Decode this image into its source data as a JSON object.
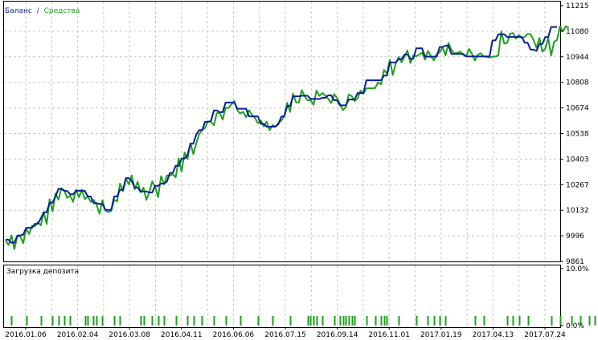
{
  "chart_data": [
    {
      "type": "line",
      "title": "",
      "legend": {
        "placement": "top-left",
        "separator": "/"
      },
      "xlabel": "",
      "ylabel": "",
      "ylim": [
        9861,
        11215
      ],
      "y_ticks": [
        "11215",
        "11080",
        "10944",
        "10808",
        "10674",
        "10538",
        "10403",
        "10267",
        "10132",
        "9996",
        "9861"
      ],
      "x_ticks": [
        "2016.01.06",
        "2016.02.04",
        "2016.03.08",
        "2016.04.11",
        "2016.06.06",
        "2016.07.15",
        "2016.09.14",
        "2016.11.01",
        "2017.01.19",
        "2017.04.13",
        "2017.07.24"
      ],
      "grid": true,
      "series": [
        {
          "name": "Баланс",
          "color": "#0a1f96",
          "values": [
            9976,
            9976,
            9960,
            9960,
            9998,
            9998,
            10003,
            10039,
            10039,
            10039,
            10060,
            10060,
            10089,
            10121,
            10121,
            10172,
            10172,
            10203,
            10245,
            10245,
            10234,
            10234,
            10216,
            10216,
            10235,
            10235,
            10235,
            10235,
            10205,
            10205,
            10169,
            10169,
            10165,
            10165,
            10134,
            10134,
            10134,
            10205,
            10205,
            10240,
            10240,
            10302,
            10302,
            10285,
            10252,
            10252,
            10231,
            10231,
            10231,
            10226,
            10226,
            10261,
            10261,
            10273,
            10273,
            10284,
            10329,
            10329,
            10367,
            10367,
            10405,
            10405,
            10423,
            10484,
            10484,
            10533,
            10556,
            10556,
            10600,
            10600,
            10603,
            10660,
            10660,
            10651,
            10651,
            10702,
            10702,
            10702,
            10702,
            10669,
            10669,
            10669,
            10669,
            10629,
            10629,
            10629,
            10629,
            10589,
            10589,
            10574,
            10574,
            10574,
            10574,
            10588,
            10628,
            10628,
            10683,
            10683,
            10735,
            10735,
            10735,
            10738,
            10738,
            10738,
            10721,
            10721,
            10721,
            10721,
            10727,
            10727,
            10740,
            10740,
            10714,
            10714,
            10687,
            10687,
            10687,
            10718,
            10718,
            10718,
            10752,
            10752,
            10752,
            10820,
            10820,
            10820,
            10820,
            10820,
            10820,
            10845,
            10845,
            10914,
            10914,
            10914,
            10932,
            10932,
            10956,
            10956,
            10933,
            10933,
            10989,
            10989,
            10989,
            10945,
            10945,
            10945,
            10945,
            10945,
            10996,
            10996,
            11003,
            11003,
            10959,
            10959,
            10959,
            10959,
            10959,
            10946,
            10946,
            10946,
            10946,
            10946,
            10946,
            10946,
            10946,
            10946,
            11031,
            11031,
            11063,
            11063,
            11063,
            11049,
            11049,
            11049,
            11049,
            11049,
            11049,
            11018,
            11018,
            10982,
            10982,
            10975,
            11012,
            11012,
            11048,
            11048,
            11102,
            11102,
            11102
          ]
        },
        {
          "name": "Средства",
          "color": "#1ea01e",
          "values": [
            9972,
            9948,
            9998,
            9926,
            9996,
            9994,
            9957,
            10035,
            10006,
            10050,
            10047,
            10069,
            10052,
            10122,
            10059,
            10190,
            10126,
            10221,
            10188,
            10248,
            10237,
            10197,
            10209,
            10177,
            10241,
            10201,
            10240,
            10191,
            10205,
            10176,
            10187,
            10161,
            10113,
            10185,
            10130,
            10122,
            10128,
            10187,
            10179,
            10273,
            10232,
            10299,
            10269,
            10316,
            10242,
            10283,
            10227,
            10251,
            10187,
            10227,
            10285,
            10255,
            10201,
            10312,
            10269,
            10316,
            10315,
            10322,
            10306,
            10407,
            10336,
            10438,
            10402,
            10487,
            10429,
            10486,
            10535,
            10556,
            10568,
            10603,
            10600,
            10582,
            10646,
            10647,
            10612,
            10675,
            10672,
            10693,
            10710,
            10660,
            10644,
            10653,
            10624,
            10661,
            10637,
            10620,
            10593,
            10607,
            10575,
            10601,
            10555,
            10583,
            10574,
            10594,
            10606,
            10630,
            10701,
            10652,
            10750,
            10703,
            10702,
            10768,
            10734,
            10714,
            10714,
            10690,
            10765,
            10737,
            10752,
            10740,
            10721,
            10699,
            10746,
            10726,
            10695,
            10662,
            10678,
            10745,
            10736,
            10710,
            10723,
            10765,
            10750,
            10777,
            10778,
            10777,
            10779,
            10809,
            10798,
            10875,
            10855,
            10928,
            10848,
            10908,
            10943,
            10915,
            10945,
            10978,
            10911,
            10951,
            10947,
            10956,
            10966,
            10929,
            10975,
            10948,
            10925,
            10959,
            10968,
            10994,
            10952,
            11017,
            10981,
            10962,
            10964,
            10972,
            10955,
            10946,
            10986,
            10960,
            10925,
            10955,
            10963,
            10946,
            10944,
            10940,
            10944,
            10946,
            10951,
            11078,
            11014,
            11018,
            11066,
            11070,
            11040,
            11060,
            11043,
            11050,
            11065,
            11063,
            11033,
            10992,
            11044,
            10971,
            10987,
            11044,
            10951,
            11023,
            11033,
            11105,
            11078,
            11105,
            11100
          ]
        }
      ]
    },
    {
      "type": "bar",
      "title": "Загрузка депозита",
      "y_ticks": [
        "10.0%",
        "0.0%"
      ],
      "ylim": [
        0,
        10
      ],
      "x_ticks": [
        "2016.01.06",
        "2016.02.04",
        "2016.03.08",
        "2016.04.11",
        "2016.06.06",
        "2016.07.15",
        "2016.09.14",
        "2016.11.01",
        "2017.01.19",
        "2017.04.13",
        "2017.07.24"
      ],
      "series": [
        {
          "name": "",
          "color": "#1ea01e",
          "index": [
            2,
            7,
            12,
            16,
            18,
            20,
            22,
            27,
            28,
            30,
            31,
            33,
            37,
            39,
            46,
            47,
            50,
            52,
            54,
            58,
            62,
            64,
            67,
            71,
            75,
            80,
            86,
            91,
            97,
            103,
            104,
            105,
            106,
            108,
            112,
            114,
            115,
            116,
            117,
            118,
            119,
            123,
            126,
            128,
            129,
            130,
            134,
            140,
            144,
            146,
            148,
            150,
            160,
            163,
            171,
            173,
            175,
            178,
            186,
            189,
            193,
            196,
            199,
            201
          ],
          "values": [
            1.7,
            1.7,
            1.7,
            1.7,
            1.7,
            1.7,
            1.7,
            1.7,
            1.7,
            1.7,
            1.7,
            1.7,
            1.7,
            1.7,
            1.7,
            1.7,
            1.7,
            1.7,
            1.7,
            1.7,
            1.7,
            1.7,
            1.7,
            1.7,
            1.7,
            1.7,
            1.7,
            1.7,
            1.7,
            1.7,
            1.7,
            1.7,
            1.7,
            1.7,
            1.7,
            1.7,
            1.7,
            1.7,
            1.7,
            1.7,
            1.7,
            1.7,
            1.7,
            1.7,
            1.7,
            1.7,
            1.7,
            1.7,
            1.7,
            1.7,
            1.7,
            1.7,
            1.7,
            1.7,
            1.7,
            1.7,
            1.7,
            1.7,
            1.7,
            1.7,
            1.7,
            1.7,
            1.7,
            1.7
          ]
        }
      ]
    }
  ]
}
